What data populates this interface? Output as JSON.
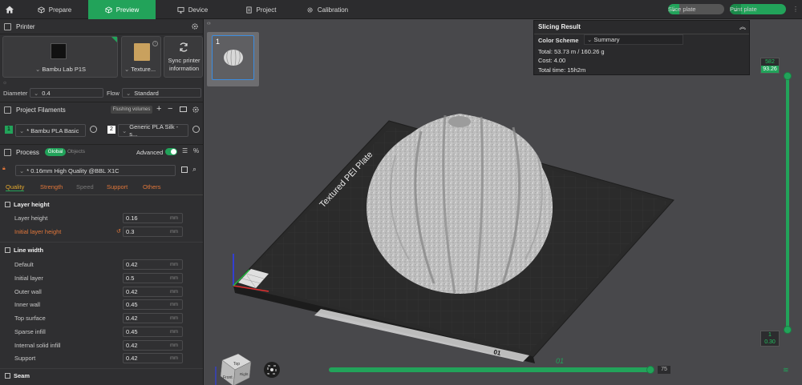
{
  "topbar": {
    "tabs": [
      {
        "label": "Prepare",
        "icon": "cube-icon"
      },
      {
        "label": "Preview",
        "icon": "cube-outline-icon"
      },
      {
        "label": "Device",
        "icon": "monitor-icon"
      },
      {
        "label": "Project",
        "icon": "document-icon"
      },
      {
        "label": "Calibration",
        "icon": "gear-icon"
      }
    ],
    "slice_label": "Slice plate",
    "print_label": "Print plate"
  },
  "printer": {
    "header": "Printer",
    "name": "Bambu Lab P1S",
    "plate": "Texture...",
    "sync_label_1": "Sync printer",
    "sync_label_2": "information",
    "diameter_label": "Diameter",
    "diameter_value": "0.4",
    "flow_label": "Flow",
    "flow_value": "Standard"
  },
  "filaments": {
    "header": "Project Filaments",
    "flushing": "Flushing volumes",
    "items": [
      {
        "num": "1",
        "name": "* Bambu PLA Basic",
        "color": "#22a35a"
      },
      {
        "num": "2",
        "name": "Generic PLA Silk - s...",
        "color": "#ffffff"
      }
    ]
  },
  "process": {
    "header": "Process",
    "global": "Global",
    "objects": "Objects",
    "advanced": "Advanced",
    "preset": "* 0.16mm High Quality @BBL X1C",
    "tabs": [
      "Quality",
      "Strength",
      "Speed",
      "Support",
      "Others"
    ],
    "groups": {
      "layer_height": {
        "title": "Layer height",
        "rows": [
          {
            "label": "Layer height",
            "value": "0.16",
            "unit": "mm"
          },
          {
            "label": "Initial layer height",
            "value": "0.3",
            "unit": "mm"
          }
        ]
      },
      "line_width": {
        "title": "Line width",
        "rows": [
          {
            "label": "Default",
            "value": "0.42",
            "unit": "mm"
          },
          {
            "label": "Initial layer",
            "value": "0.5",
            "unit": "mm"
          },
          {
            "label": "Outer wall",
            "value": "0.42",
            "unit": "mm"
          },
          {
            "label": "Inner wall",
            "value": "0.45",
            "unit": "mm"
          },
          {
            "label": "Top surface",
            "value": "0.42",
            "unit": "mm"
          },
          {
            "label": "Sparse infill",
            "value": "0.45",
            "unit": "mm"
          },
          {
            "label": "Internal solid infill",
            "value": "0.42",
            "unit": "mm"
          },
          {
            "label": "Support",
            "value": "0.42",
            "unit": "mm"
          }
        ]
      },
      "seam": {
        "title": "Seam"
      }
    }
  },
  "viewport": {
    "plate_number": "1",
    "plate_text": "Textured PEI Plate",
    "plate_label": "01",
    "cube_faces": {
      "top": "Top",
      "front": "Front",
      "right": "Right"
    }
  },
  "slicing_result": {
    "title": "Slicing Result",
    "color_scheme_label": "Color Scheme",
    "color_scheme_value": "Summary",
    "total": "Total:   53.73 m / 160.26 g",
    "cost": "Cost:   4.00",
    "time": "Total time:   15h2m"
  },
  "layers": {
    "top_layer": "582",
    "top_height": "93.26",
    "bottom_layer": "1",
    "bottom_height": "0.30",
    "move_number": "75"
  }
}
